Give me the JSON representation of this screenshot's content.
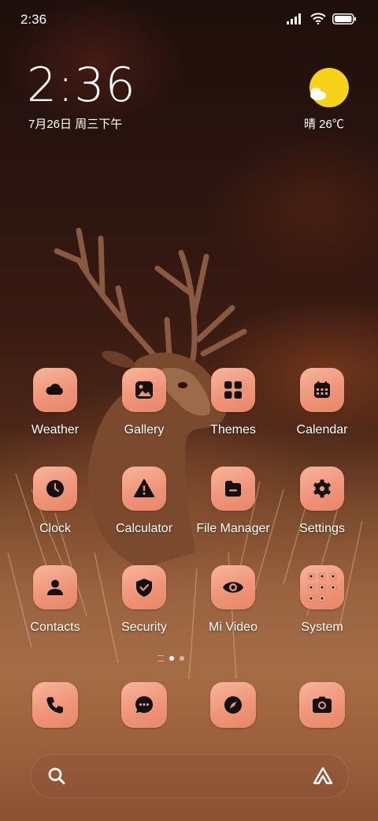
{
  "status_bar": {
    "time": "2:36",
    "icons": [
      "signal-icon",
      "wifi-icon",
      "battery-icon"
    ]
  },
  "clock_widget": {
    "time": "2:36",
    "date": "7月26日 周三下午"
  },
  "weather_widget": {
    "condition_temp": "晴 26℃",
    "icon": "sun-cloud-icon"
  },
  "apps": [
    {
      "name": "weather",
      "label": "Weather",
      "icon": "cloud-icon"
    },
    {
      "name": "gallery",
      "label": "Gallery",
      "icon": "image-icon"
    },
    {
      "name": "themes",
      "label": "Themes",
      "icon": "grid-icon"
    },
    {
      "name": "calendar",
      "label": "Calendar",
      "icon": "calendar-icon"
    },
    {
      "name": "clock",
      "label": "Clock",
      "icon": "clock-icon"
    },
    {
      "name": "calculator",
      "label": "Calculator",
      "icon": "warning-icon"
    },
    {
      "name": "file-manager",
      "label": "File Manager",
      "icon": "folder-icon"
    },
    {
      "name": "settings",
      "label": "Settings",
      "icon": "gear-icon"
    },
    {
      "name": "contacts",
      "label": "Contacts",
      "icon": "person-icon"
    },
    {
      "name": "security",
      "label": "Security",
      "icon": "shield-icon"
    },
    {
      "name": "mi-video",
      "label": "Mi Video",
      "icon": "eye-icon"
    },
    {
      "name": "system",
      "label": "System",
      "icon": "folder-grid-icon"
    }
  ],
  "page_indicator": {
    "pages": 2,
    "active": 1
  },
  "dock": [
    {
      "name": "phone",
      "icon": "phone-icon"
    },
    {
      "name": "messages",
      "icon": "chat-icon"
    },
    {
      "name": "browser",
      "icon": "compass-icon"
    },
    {
      "name": "camera",
      "icon": "camera-icon"
    }
  ],
  "search_bar": {
    "left_icon": "search-icon",
    "right_icon": "assistant-icon"
  },
  "colors": {
    "tile_top": "#f7b59a",
    "tile_bottom": "#e88768",
    "sun": "#f7d21a"
  }
}
